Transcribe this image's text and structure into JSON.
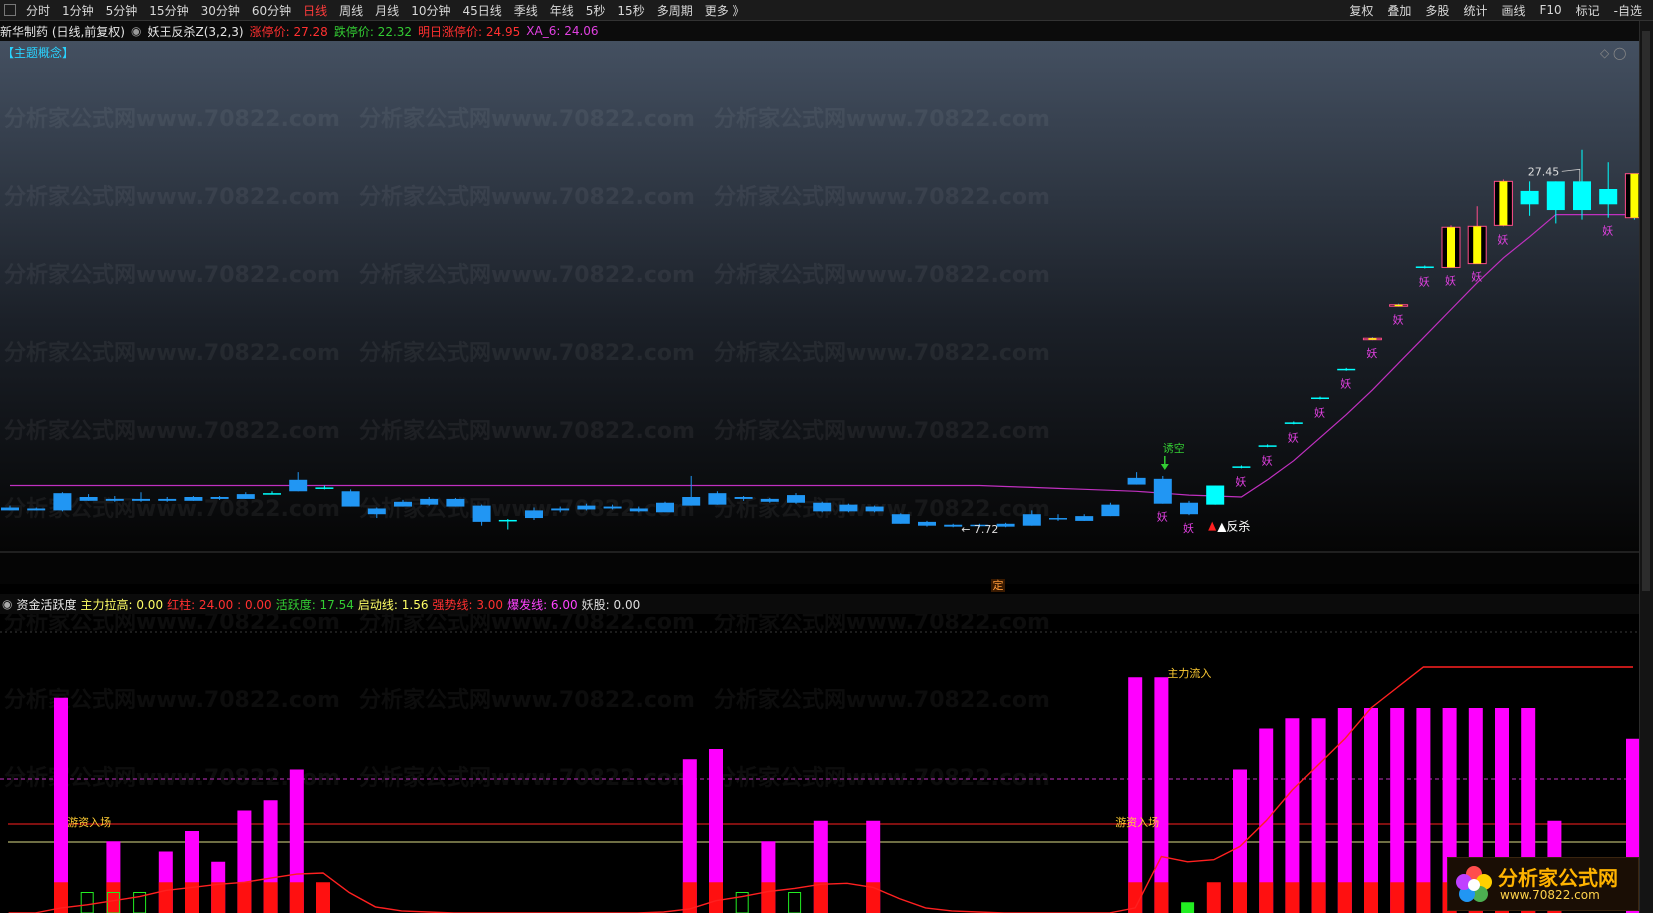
{
  "toolbar": {
    "periods": [
      "分时",
      "1分钟",
      "5分钟",
      "15分钟",
      "30分钟",
      "60分钟",
      "日线",
      "周线",
      "月线",
      "10分钟",
      "45日线",
      "季线",
      "年线",
      "5秒",
      "15秒",
      "多周期",
      "更多 》"
    ],
    "active_period": "日线",
    "right_items": [
      "复权",
      "叠加",
      "多股",
      "统计",
      "画线",
      "F10",
      "标记",
      "-自选"
    ]
  },
  "info": {
    "stock": "新华制药 (日线,前复权)",
    "indicator": "妖王反杀Z(3,2,3)",
    "limit_up": "涨停价: 27.28",
    "limit_down": "跌停价: 22.32",
    "next_limit_up": "明日涨停价: 24.95",
    "xa6": "XA_6: 24.06"
  },
  "theme_tag": "【主题概念】",
  "watermark": "分析家公式网www.70822.com",
  "colors": {
    "up": "#00ffff",
    "down": "#2196f3",
    "yao_label": "#e040e0",
    "line_main": "#c030c0",
    "yellow": "#ffff00",
    "magenta_bar": "#ff00ff",
    "red_bar": "#ff1010",
    "red_line": "#ff2020"
  },
  "sub": {
    "title": "资金活跃度",
    "items": [
      {
        "label": "主力拉高: 0.00",
        "color": "#ffff66"
      },
      {
        "label": "红柱: 24.00 : 0.00",
        "color": "#ff3030",
        "extra": ": 0.00"
      },
      {
        "label": "活跃度: 17.54",
        "color": "#33cc33"
      },
      {
        "label": "启动线: 1.56",
        "color": "#ffff66"
      },
      {
        "label": "强势线: 3.00",
        "color": "#ff3030"
      },
      {
        "label": "爆发线: 6.00",
        "color": "#ff44ff"
      },
      {
        "label": "妖股: 0.00",
        "color": "#dddddd"
      }
    ]
  },
  "ding_label": "定",
  "logo": {
    "text": "分析家公式网",
    "url": "www.70822.com"
  },
  "chart_data": [
    {
      "type": "candlestick",
      "title": "妖王反杀Z(3,2,3)",
      "price_range": [
        7.0,
        30.0
      ],
      "candles": [
        {
          "o": 8.75,
          "h": 8.85,
          "l": 8.6,
          "c": 8.6
        },
        {
          "o": 8.7,
          "h": 8.75,
          "l": 8.6,
          "c": 8.6
        },
        {
          "o": 9.5,
          "h": 9.55,
          "l": 8.55,
          "c": 8.6
        },
        {
          "o": 9.3,
          "h": 9.45,
          "l": 9.1,
          "c": 9.1
        },
        {
          "o": 9.2,
          "h": 9.35,
          "l": 9.05,
          "c": 9.1
        },
        {
          "o": 9.2,
          "h": 9.55,
          "l": 9.05,
          "c": 9.1
        },
        {
          "o": 9.2,
          "h": 9.3,
          "l": 9.05,
          "c": 9.1
        },
        {
          "o": 9.3,
          "h": 9.35,
          "l": 9.1,
          "c": 9.1
        },
        {
          "o": 9.3,
          "h": 9.35,
          "l": 9.15,
          "c": 9.2
        },
        {
          "o": 9.45,
          "h": 9.55,
          "l": 9.2,
          "c": 9.2
        },
        {
          "o": 9.5,
          "h": 9.6,
          "l": 9.45,
          "c": 9.5
        },
        {
          "o": 10.2,
          "h": 10.6,
          "l": 9.6,
          "c": 9.6
        },
        {
          "o": 9.8,
          "h": 9.9,
          "l": 9.7,
          "c": 9.8
        },
        {
          "o": 9.6,
          "h": 9.7,
          "l": 8.8,
          "c": 8.8
        },
        {
          "o": 8.7,
          "h": 8.75,
          "l": 8.2,
          "c": 8.4
        },
        {
          "o": 9.05,
          "h": 9.15,
          "l": 8.8,
          "c": 8.8
        },
        {
          "o": 9.2,
          "h": 9.3,
          "l": 8.85,
          "c": 8.9
        },
        {
          "o": 9.2,
          "h": 9.25,
          "l": 8.8,
          "c": 8.8
        },
        {
          "o": 8.85,
          "h": 8.9,
          "l": 7.8,
          "c": 8.0
        },
        {
          "o": 8.1,
          "h": 8.15,
          "l": 7.6,
          "c": 8.1
        },
        {
          "o": 8.6,
          "h": 8.75,
          "l": 8.1,
          "c": 8.2
        },
        {
          "o": 8.7,
          "h": 8.8,
          "l": 8.5,
          "c": 8.6
        },
        {
          "o": 8.85,
          "h": 8.95,
          "l": 8.6,
          "c": 8.65
        },
        {
          "o": 8.8,
          "h": 8.9,
          "l": 8.65,
          "c": 8.7
        },
        {
          "o": 8.7,
          "h": 8.8,
          "l": 8.5,
          "c": 8.55
        },
        {
          "o": 9.0,
          "h": 9.05,
          "l": 8.5,
          "c": 8.5
        },
        {
          "o": 9.3,
          "h": 10.4,
          "l": 8.85,
          "c": 8.85
        },
        {
          "o": 9.5,
          "h": 9.6,
          "l": 8.9,
          "c": 8.9
        },
        {
          "o": 9.3,
          "h": 9.35,
          "l": 9.1,
          "c": 9.2
        },
        {
          "o": 9.2,
          "h": 9.25,
          "l": 9.0,
          "c": 9.05
        },
        {
          "o": 9.4,
          "h": 9.5,
          "l": 8.95,
          "c": 9.0
        },
        {
          "o": 9.0,
          "h": 9.05,
          "l": 8.5,
          "c": 8.55
        },
        {
          "o": 8.9,
          "h": 8.95,
          "l": 8.5,
          "c": 8.55
        },
        {
          "o": 8.8,
          "h": 8.85,
          "l": 8.5,
          "c": 8.55
        },
        {
          "o": 8.4,
          "h": 8.45,
          "l": 7.9,
          "c": 7.9
        },
        {
          "o": 8.0,
          "h": 8.05,
          "l": 7.75,
          "c": 7.8
        },
        {
          "o": 7.85,
          "h": 7.9,
          "l": 7.72,
          "c": 7.75
        },
        {
          "o": 7.85,
          "h": 7.9,
          "l": 7.72,
          "c": 7.8
        },
        {
          "o": 7.9,
          "h": 7.95,
          "l": 7.72,
          "c": 7.75
        },
        {
          "o": 8.4,
          "h": 8.6,
          "l": 7.8,
          "c": 7.8
        },
        {
          "o": 8.2,
          "h": 8.4,
          "l": 8.05,
          "c": 8.15
        },
        {
          "o": 8.3,
          "h": 8.4,
          "l": 8.05,
          "c": 8.05
        },
        {
          "o": 8.9,
          "h": 9.0,
          "l": 8.3,
          "c": 8.3
        },
        {
          "o": 10.3,
          "h": 10.6,
          "l": 9.95,
          "c": 9.95
        },
        {
          "o": 10.25,
          "h": 10.4,
          "l": 8.95,
          "c": 8.95
        },
        {
          "o": 9.0,
          "h": 9.1,
          "l": 8.35,
          "c": 8.4
        },
        {
          "o": 8.9,
          "h": 9.9,
          "l": 8.9,
          "c": 9.9
        },
        {
          "o": 10.85,
          "h": 10.95,
          "l": 10.8,
          "c": 10.9
        },
        {
          "o": 11.95,
          "h": 12.05,
          "l": 11.9,
          "c": 12.0
        },
        {
          "o": 13.15,
          "h": 13.25,
          "l": 13.1,
          "c": 13.2
        },
        {
          "o": 14.45,
          "h": 14.55,
          "l": 14.4,
          "c": 14.5
        },
        {
          "o": 15.95,
          "h": 16.05,
          "l": 15.9,
          "c": 16.0
        },
        {
          "o": 17.55,
          "h": 17.65,
          "l": 17.5,
          "c": 17.6
        },
        {
          "o": 19.3,
          "h": 19.4,
          "l": 19.25,
          "c": 19.35
        },
        {
          "o": 21.3,
          "h": 21.4,
          "l": 21.25,
          "c": 21.35
        },
        {
          "o": 23.4,
          "h": 23.5,
          "l": 21.3,
          "c": 21.3
        },
        {
          "o": 23.45,
          "h": 24.5,
          "l": 21.5,
          "c": 21.5
        },
        {
          "o": 25.8,
          "h": 25.9,
          "l": 23.45,
          "c": 23.5
        },
        {
          "o": 24.6,
          "h": 25.8,
          "l": 24.0,
          "c": 25.3
        },
        {
          "o": 24.3,
          "h": 25.8,
          "l": 23.6,
          "c": 25.8
        },
        {
          "o": 24.3,
          "h": 27.45,
          "l": 23.8,
          "c": 25.8
        },
        {
          "o": 24.6,
          "h": 26.8,
          "l": 23.9,
          "c": 25.4
        },
        {
          "o": 23.9,
          "h": 26.2,
          "l": 23.8,
          "c": 26.2
        }
      ],
      "yellow_body": [
        52,
        53,
        55,
        56,
        57,
        62
      ],
      "line_values": [
        9.9,
        9.9,
        9.9,
        9.9,
        9.9,
        9.9,
        9.9,
        9.9,
        9.9,
        9.9,
        9.9,
        9.9,
        9.9,
        9.9,
        9.9,
        9.9,
        9.9,
        9.9,
        9.9,
        9.9,
        9.9,
        9.9,
        9.9,
        9.9,
        9.9,
        9.9,
        9.9,
        9.9,
        9.9,
        9.9,
        9.9,
        9.9,
        9.9,
        9.9,
        9.9,
        9.9,
        9.9,
        9.9,
        9.85,
        9.8,
        9.75,
        9.7,
        9.65,
        9.6,
        9.5,
        9.4,
        9.35,
        9.3,
        10.2,
        11.2,
        12.4,
        13.6,
        14.9,
        16.3,
        17.7,
        19.1,
        20.5,
        21.8,
        22.9,
        24.06,
        24.06,
        24.06,
        24.06
      ],
      "yao_markers": [
        44,
        45,
        47,
        48,
        49,
        50,
        51,
        52,
        53,
        54,
        55,
        56,
        57,
        61
      ],
      "annotations": [
        {
          "label": "诱空",
          "index": 44,
          "color": "#33cc33"
        },
        {
          "label": "▲反杀",
          "index": 46,
          "color": "#ffffff"
        },
        {
          "label": "← 7.72",
          "index": 36,
          "color": "#dddddd"
        },
        {
          "label": "27.45",
          "index": 59,
          "color": "#dddddd"
        }
      ],
      "yao_label": "妖"
    },
    {
      "type": "bar",
      "title": "资金活跃度",
      "ylim": [
        0,
        28
      ],
      "magenta": [
        0,
        0,
        21,
        0,
        7,
        0,
        6,
        8,
        5,
        10,
        11,
        14,
        0,
        0,
        0,
        0,
        0,
        0,
        0,
        0,
        0,
        0,
        0,
        0,
        0,
        0,
        15,
        16,
        0,
        7,
        0,
        9,
        0,
        9,
        0,
        0,
        0,
        0,
        0,
        0,
        0,
        0,
        0,
        23,
        23,
        0,
        0,
        14,
        18,
        19,
        19,
        20,
        20,
        20,
        20,
        20,
        20,
        20,
        20,
        9,
        0,
        0,
        17
      ],
      "red": [
        0,
        0,
        3,
        0,
        3,
        0,
        3,
        3,
        3,
        3,
        3,
        3,
        3,
        0,
        0,
        0,
        0,
        0,
        0,
        0,
        0,
        0,
        0,
        0,
        0,
        0,
        3,
        3,
        0,
        3,
        0,
        3,
        0,
        3,
        0,
        0,
        0,
        0,
        0,
        0,
        0,
        0,
        0,
        3,
        3,
        0,
        3,
        3,
        3,
        3,
        3,
        3,
        3,
        3,
        3,
        3,
        3,
        3,
        3,
        3,
        0,
        0,
        0
      ],
      "green": [
        0,
        0,
        0,
        2,
        2,
        2,
        0,
        0,
        0,
        0,
        0,
        0,
        0,
        0,
        0,
        0,
        0,
        0,
        0,
        0,
        0,
        0,
        0,
        0,
        0,
        0,
        0,
        0,
        2,
        0,
        2,
        0,
        0,
        0,
        0,
        0,
        0,
        0,
        0,
        0,
        0,
        0,
        0,
        0,
        0,
        1,
        0,
        0,
        0,
        0,
        0,
        0,
        0,
        0,
        0,
        0,
        0,
        0,
        0,
        0,
        0,
        0,
        0
      ],
      "red_line": [
        0,
        0,
        0.5,
        0.8,
        1.2,
        1.6,
        2.2,
        2.5,
        2.8,
        3.0,
        3.4,
        3.8,
        3.9,
        2.0,
        0.6,
        0.2,
        0.1,
        0,
        0,
        0,
        0,
        0,
        0,
        0,
        0,
        0.1,
        0.4,
        1.2,
        1.6,
        2.1,
        2.4,
        2.8,
        2.9,
        2.5,
        1.4,
        0.5,
        0.2,
        0.1,
        0,
        0,
        0,
        0,
        0,
        0.5,
        5.5,
        5.0,
        5.2,
        6.5,
        9.0,
        12.0,
        14.5,
        17.0,
        20.0,
        22.0,
        24.0,
        24.0,
        24.0,
        24.0,
        24.0,
        24.0,
        24.0,
        24.0,
        24.0
      ],
      "labels": [
        {
          "label": "游资入场",
          "index": 3,
          "color": "#ffcc33"
        },
        {
          "label": "游资入场",
          "index": 43,
          "color": "#ffcc33"
        },
        {
          "label": "主力流入",
          "index": 44,
          "color": "#ffcc33"
        }
      ],
      "ref_lines": {
        "start": 1.56,
        "strong": 3.0,
        "burst": 6.0
      }
    }
  ]
}
